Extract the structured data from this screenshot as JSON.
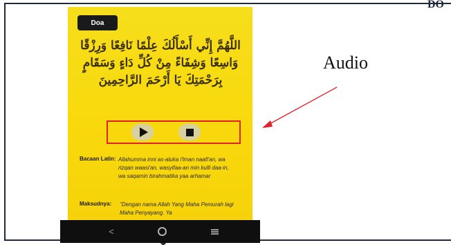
{
  "corner_label": "DO",
  "app": {
    "tag_label": "Doa",
    "arabic_text": "اللَّهُمَّ إِنِّي أَسْأَلُكَ عِلْمًا نَافِعًا وَرِزْقًا وَاسِعًا وَشِفَاءً مِنْ كُلِّ دَاءٍ وَسَقَامٍ بِرَحْمَتِكَ يَا أَرْحَمَ الرَّاحِمِينَ",
    "controls": {
      "play_icon": "play-icon",
      "stop_icon": "stop-icon"
    },
    "latin": {
      "label": "Bacaan Latin:",
      "text": "Allahumma inni as-aluka i'lman naafi'an, wa rizqan waasi'an, wasyifaa-an min kulli daa-in, wa saqamin birahmatika yaa arhamar"
    },
    "meaning": {
      "label": "Maksudnya:",
      "text": "\"Dengan nama Allah Yang Maha Pemurah lagi Maha Penyayang. Ya"
    },
    "nav": {
      "back_glyph": "<",
      "home_icon": "home-icon",
      "menu_icon": "menu-icon"
    },
    "colors": {
      "background": "#f6d80e",
      "highlight": "#e0202a"
    }
  },
  "annotation": {
    "label": "Audio"
  }
}
